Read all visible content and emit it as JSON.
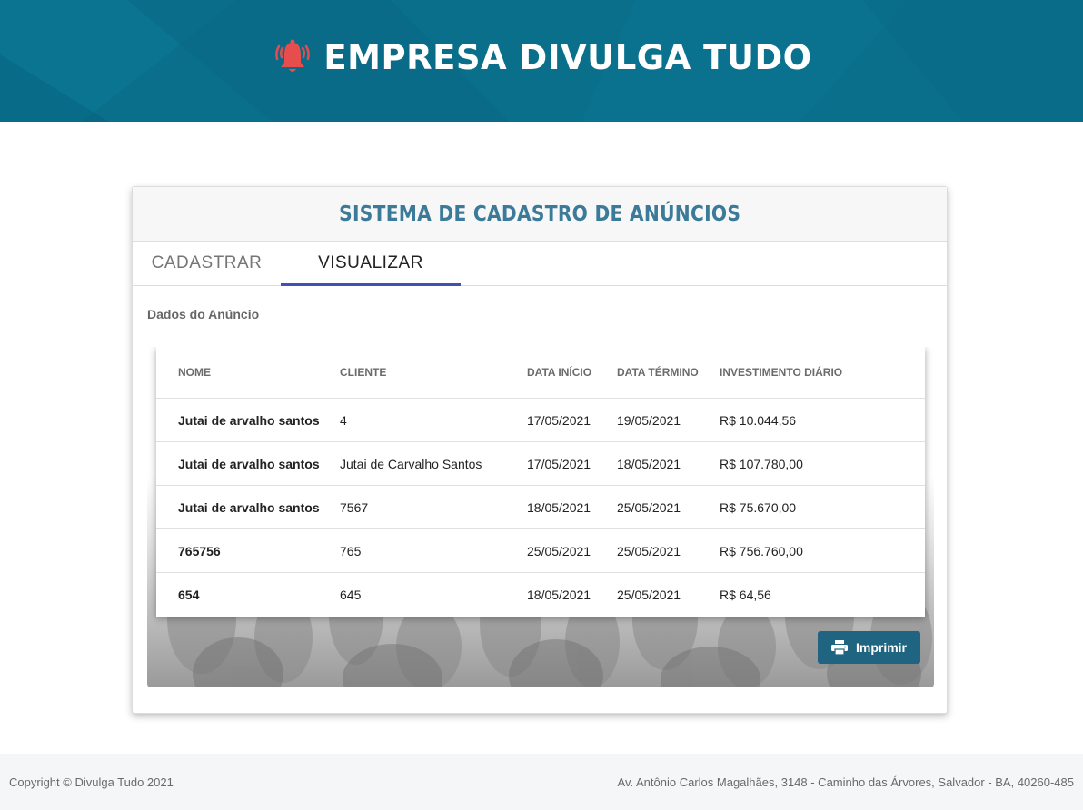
{
  "header": {
    "title": "EMPRESA DIVULGA TUDO",
    "icon": "bell-alarm-icon",
    "background": "#0a6f8a"
  },
  "card": {
    "title": "SISTEMA DE CADASTRO DE ANÚNCIOS",
    "tabs": [
      {
        "label": "CADASTRAR",
        "active": false
      },
      {
        "label": "VISUALIZAR",
        "active": true
      }
    ],
    "section_label": "Dados do Anúncio"
  },
  "table": {
    "columns": [
      "NOME",
      "CLIENTE",
      "DATA INÍCIO",
      "DATA TÉRMINO",
      "INVESTIMENTO DIÁRIO"
    ],
    "rows": [
      [
        "Jutai de arvalho santos",
        "4",
        "17/05/2021",
        "19/05/2021",
        "R$ 10.044,56"
      ],
      [
        "Jutai de arvalho santos",
        "Jutai de Carvalho Santos",
        "17/05/2021",
        "18/05/2021",
        "R$ 107.780,00"
      ],
      [
        "Jutai de arvalho santos",
        "7567",
        "18/05/2021",
        "25/05/2021",
        "R$ 75.670,00"
      ],
      [
        "765756",
        "765",
        "25/05/2021",
        "25/05/2021",
        "R$ 756.760,00"
      ],
      [
        "654",
        "645",
        "18/05/2021",
        "25/05/2021",
        "R$ 64,56"
      ]
    ]
  },
  "print_button": {
    "label": "Imprimir",
    "icon": "printer-icon",
    "color": "#1f6582"
  },
  "footer": {
    "copyright": "Copyright © Divulga Tudo 2021",
    "address": "Av. Antônio Carlos Magalhães, 3148 - Caminho das Árvores, Salvador - BA, 40260-485"
  }
}
